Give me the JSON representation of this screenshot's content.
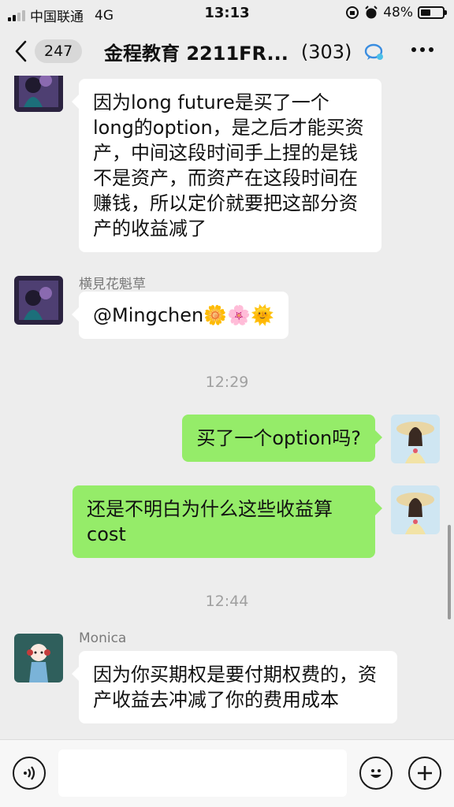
{
  "status_bar": {
    "carrier": "中国联通",
    "network": "4G",
    "time": "13:13",
    "battery": "48%",
    "battery_level": 0.48
  },
  "nav": {
    "back_count": "247",
    "title": "金程教育 2211FR...",
    "member_count": "(303)"
  },
  "messages": [
    {
      "sender": "",
      "text": "因为long future是买了一个long的option，是之后才能买资产，中间这段时间手上捏的是钱不是资产，而资产在这段时间在赚钱，所以定价就要把这部分资产的收益减了"
    },
    {
      "sender": "横見花魁草",
      "text": "@Mingchen🌼🌸🌞"
    },
    {
      "timestamp": "12:29"
    },
    {
      "sender": "me",
      "text": "买了一个option吗?"
    },
    {
      "sender": "me",
      "text": "还是不明白为什么这些收益算cost"
    },
    {
      "timestamp": "12:44"
    },
    {
      "sender": "Monica",
      "text": "因为你买期权是要付期权费的，资产收益去冲减了你的费用成本"
    }
  ],
  "input_bar": {
    "placeholder": ""
  },
  "icons": {
    "voice": "voice-icon",
    "emoji": "emoji-icon",
    "plus": "plus-icon",
    "back": "chevron-left-icon",
    "more": "more-icon",
    "group": "group-chat-icon"
  }
}
